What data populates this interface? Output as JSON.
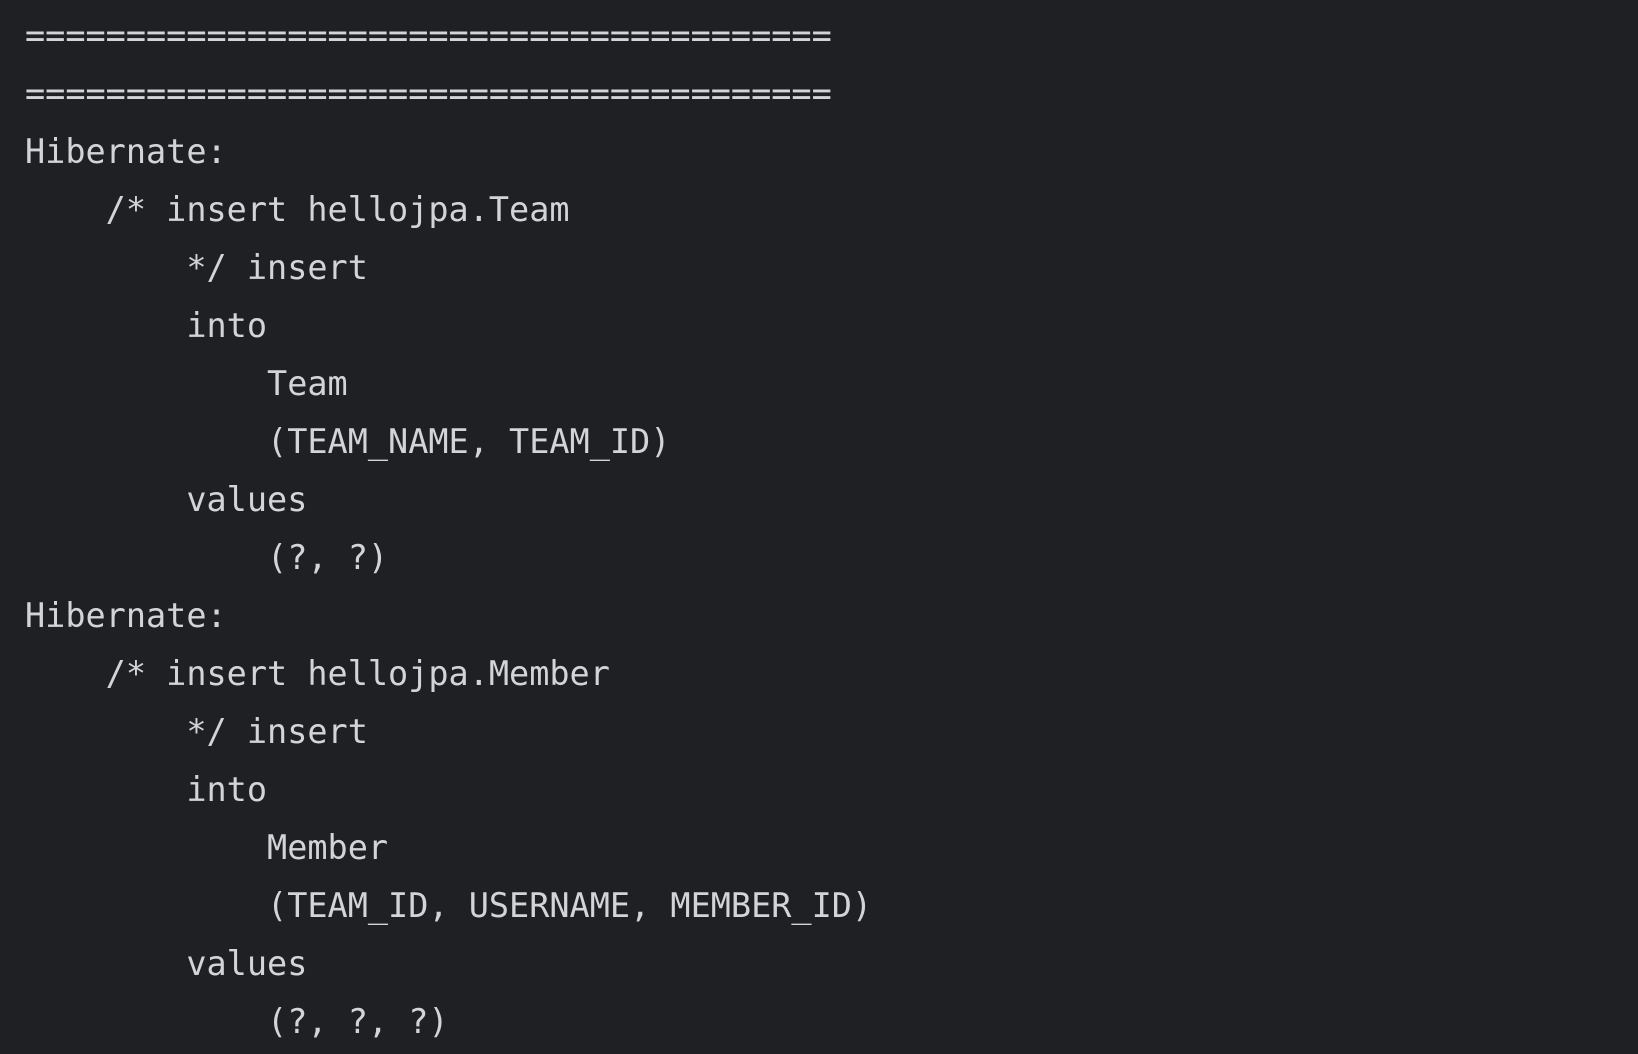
{
  "console": {
    "lines": [
      "========================================",
      "========================================",
      "Hibernate: ",
      "    /* insert hellojpa.Team",
      "        */ insert ",
      "        into",
      "            Team",
      "            (TEAM_NAME, TEAM_ID) ",
      "        values",
      "            (?, ?)",
      "Hibernate: ",
      "    /* insert hellojpa.Member",
      "        */ insert ",
      "        into",
      "            Member",
      "            (TEAM_ID, USERNAME, MEMBER_ID) ",
      "        values",
      "            (?, ?, ?)"
    ]
  }
}
